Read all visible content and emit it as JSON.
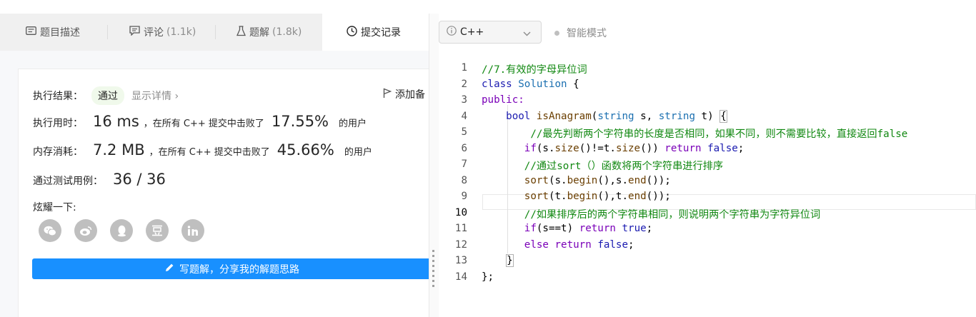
{
  "tabs": [
    {
      "label": "题目描述",
      "count": "",
      "icon": "description-icon"
    },
    {
      "label": "评论",
      "count": "(1.1k)",
      "icon": "comment-icon"
    },
    {
      "label": "题解",
      "count": "(1.8k)",
      "icon": "flask-icon"
    },
    {
      "label": "提交记录",
      "count": "",
      "icon": "clock-icon"
    }
  ],
  "result": {
    "label": "执行结果：",
    "status": "通过",
    "detail": "显示详情",
    "add_note": "添加备"
  },
  "runtime": {
    "label": "执行用时：",
    "value": "16 ms",
    "prefix": "，在所有 C++ 提交中击败了",
    "percent": "17.55%",
    "suffix": "的用户"
  },
  "memory": {
    "label": "内存消耗：",
    "value": "7.2 MB",
    "prefix": "，在所有 C++ 提交中击败了",
    "percent": "45.66%",
    "suffix": "的用户"
  },
  "testcases": {
    "label": "通过测试用例：",
    "value": "36 / 36"
  },
  "share": {
    "label": "炫耀一下:",
    "icons": [
      "wechat-icon",
      "weibo-icon",
      "qq-icon",
      "douban-icon",
      "linkedin-icon"
    ]
  },
  "write_button": "写题解，分享我的解题思路",
  "editor": {
    "language": "C++",
    "smart_mode": "智能模式",
    "current_line": 10,
    "lines": [
      "//7.有效的字母异位词",
      "class Solution {",
      "public:",
      "    bool isAnagram(string s, string t) {",
      "        //最先判断两个字符串的长度是否相同，如果不同，则不需要比较，直接返回false",
      "       if(s.size()!=t.size()) return false;",
      "       //通过sort（）函数将两个字符串进行排序",
      "       sort(s.begin(),s.end());",
      "       sort(t.begin(),t.end());",
      "       //如果排序后的两个字符串相同，则说明两个字符串为字符异位词",
      "       if(s==t) return true;",
      "       else return false;",
      "    }",
      "};"
    ]
  },
  "colors": {
    "accent": "#1890ff",
    "pass_bg": "#f0f9eb",
    "comment": "#118811",
    "keyword": "#7a00b8"
  }
}
